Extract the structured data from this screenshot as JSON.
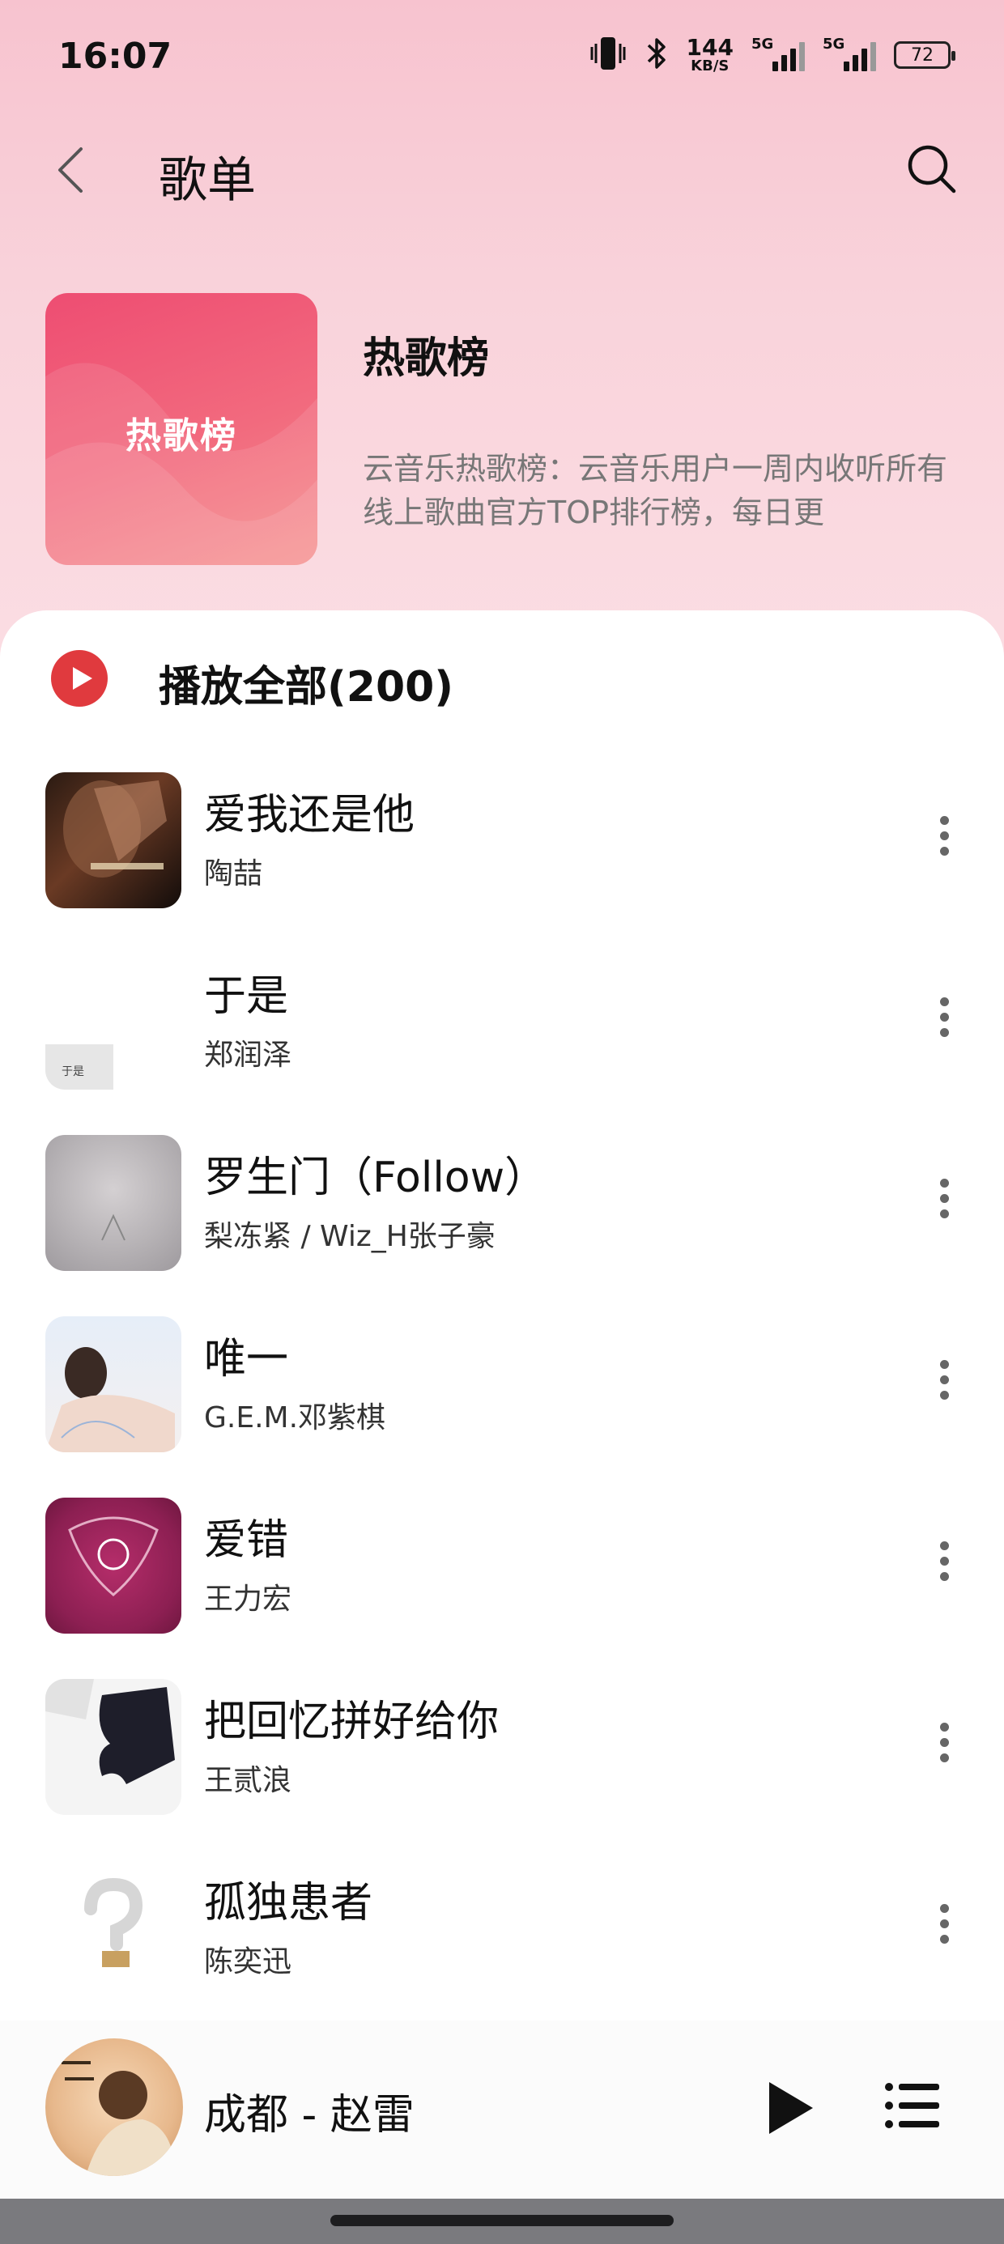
{
  "status_bar": {
    "time": "16:07",
    "speed_value": "144",
    "speed_unit": "KB/S",
    "sim1_label": "5G",
    "sim2_label": "5G",
    "battery": "72"
  },
  "header": {
    "title": "歌单"
  },
  "playlist": {
    "cover_text": "热歌榜",
    "title": "热歌榜",
    "description": "云音乐热歌榜：云音乐用户一周内收听所有线上歌曲官方TOP排行榜，每日更"
  },
  "play_all": {
    "label": "播放全部(200)"
  },
  "songs": [
    {
      "title": "爱我还是他",
      "artist": "陶喆"
    },
    {
      "title": "于是",
      "artist": "郑润泽"
    },
    {
      "title": "罗生门（Follow）",
      "artist": "梨冻紧 / Wiz_H张子豪"
    },
    {
      "title": "唯一",
      "artist": "G.E.M.邓紫棋"
    },
    {
      "title": "爱错",
      "artist": "王力宏"
    },
    {
      "title": "把回忆拼好给你",
      "artist": "王贰浪"
    },
    {
      "title": "孤独患者",
      "artist": "陈奕迅"
    }
  ],
  "mini_player": {
    "now_playing": "成都 - 赵雷"
  },
  "colors": {
    "accent": "#e03a3e",
    "header_bg": "#f8cbd5",
    "cover_gradient_start": "#ee4d72",
    "cover_gradient_end": "#f48d8c"
  }
}
